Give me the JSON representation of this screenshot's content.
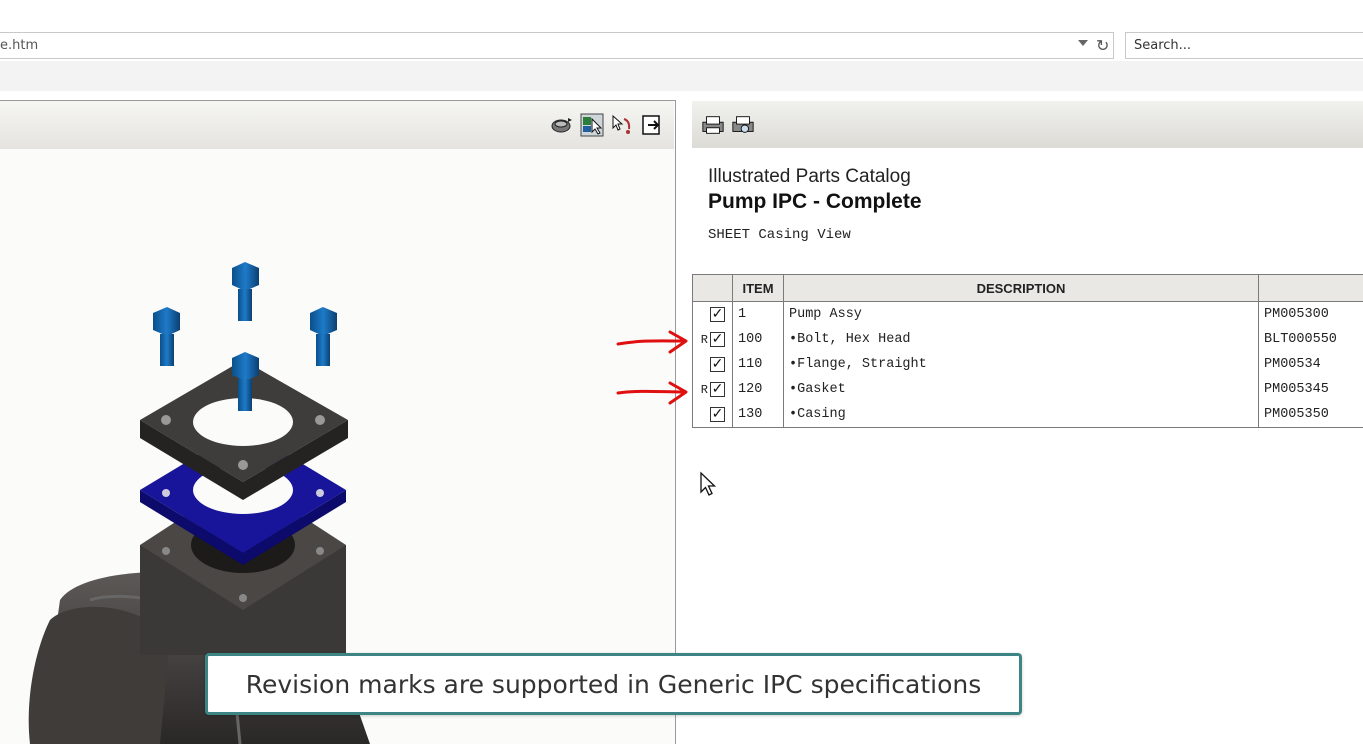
{
  "browser": {
    "address": "e.htm",
    "search_placeholder": "Search..."
  },
  "viewer": {
    "tools": [
      "rotate-view-icon",
      "select-part-icon",
      "pick-tool-icon",
      "exit-view-icon"
    ]
  },
  "catalog": {
    "tools": [
      "print-icon",
      "print-preview-icon"
    ],
    "subtitle": "Illustrated Parts Catalog",
    "title": "Pump IPC - Complete",
    "sheet": "SHEET Casing View",
    "columns": [
      "",
      "ITEM",
      "DESCRIPTION",
      ""
    ],
    "rows": [
      {
        "rev": "",
        "checked": true,
        "item": "1",
        "description": "Pump Assy",
        "part": "PM005300"
      },
      {
        "rev": "R",
        "checked": true,
        "item": "100",
        "description": "•Bolt, Hex Head",
        "part": "BLT000550"
      },
      {
        "rev": "",
        "checked": true,
        "item": "110",
        "description": "•Flange, Straight",
        "part": "PM00534"
      },
      {
        "rev": "R",
        "checked": true,
        "item": "120",
        "description": "•Gasket",
        "part": "PM005345"
      },
      {
        "rev": "",
        "checked": true,
        "item": "130",
        "description": "•Casing",
        "part": "PM005350"
      }
    ]
  },
  "annotations": {
    "arrow_color": "#e01010"
  },
  "caption": {
    "text": "Revision marks are supported in Generic IPC specifications",
    "border_color": "#3d8585"
  }
}
